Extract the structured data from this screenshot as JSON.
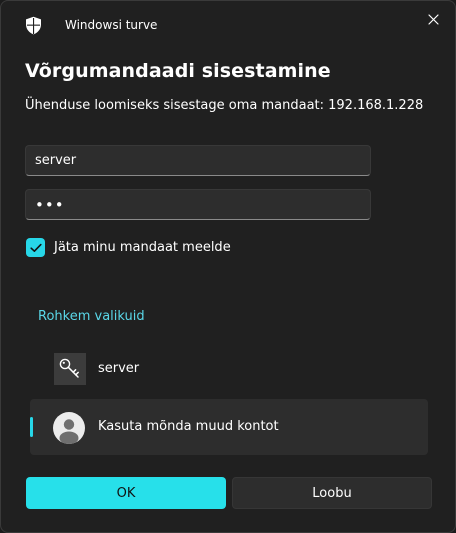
{
  "window": {
    "app_title": "Windowsi turve",
    "shield_icon": "windows-security-shield-icon",
    "close_icon": "close-icon"
  },
  "dialog": {
    "heading": "Võrgumandaadi sisestamine",
    "subtext": "Ühenduse loomiseks sisestage oma mandaat: 192.168.1.228"
  },
  "form": {
    "username_value": "server",
    "password_value": "•••",
    "remember": {
      "label": "Jäta minu mandaat meelde",
      "checked": true
    }
  },
  "more_options": {
    "link_label": "Rohkem valikuid",
    "accounts": [
      {
        "name": "server",
        "icon": "key-icon",
        "selected": false
      },
      {
        "name": "Kasuta mõnda muud kontot",
        "icon": "user-avatar-icon",
        "selected": true
      }
    ]
  },
  "buttons": {
    "ok_label": "OK",
    "cancel_label": "Loobu"
  },
  "colors": {
    "accent": "#27e0ea",
    "background": "#202020",
    "field_background": "#2d2d2d"
  }
}
